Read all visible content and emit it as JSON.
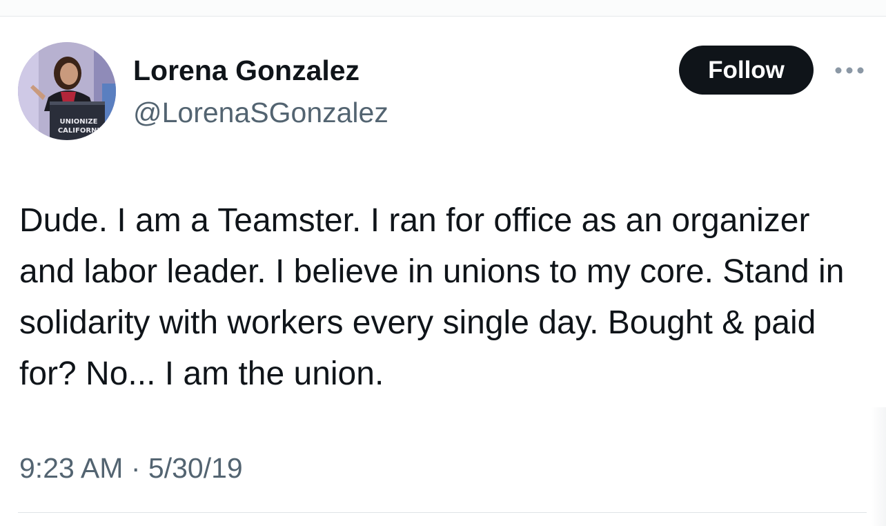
{
  "author": {
    "name": "Lorena Gonzalez",
    "handle": "@LorenaSGonzalez",
    "avatar_sign_text": [
      "UNIONIZE",
      "CALIFORNI"
    ]
  },
  "actions": {
    "follow_label": "Follow",
    "more_icon": "more-horizontal-icon"
  },
  "tweet": {
    "text": "Dude. I am a Teamster. I ran for office as an organizer and labor leader. I believe in unions to my core. Stand in solidarity with workers every single day. Bought & paid for? No... I am the union.",
    "time": "9:23 AM",
    "separator": "·",
    "date": "5/30/19"
  },
  "colors": {
    "text_primary": "#0f1419",
    "text_secondary": "#536471",
    "follow_bg": "#0f1419",
    "divider": "#e6e9eb"
  }
}
